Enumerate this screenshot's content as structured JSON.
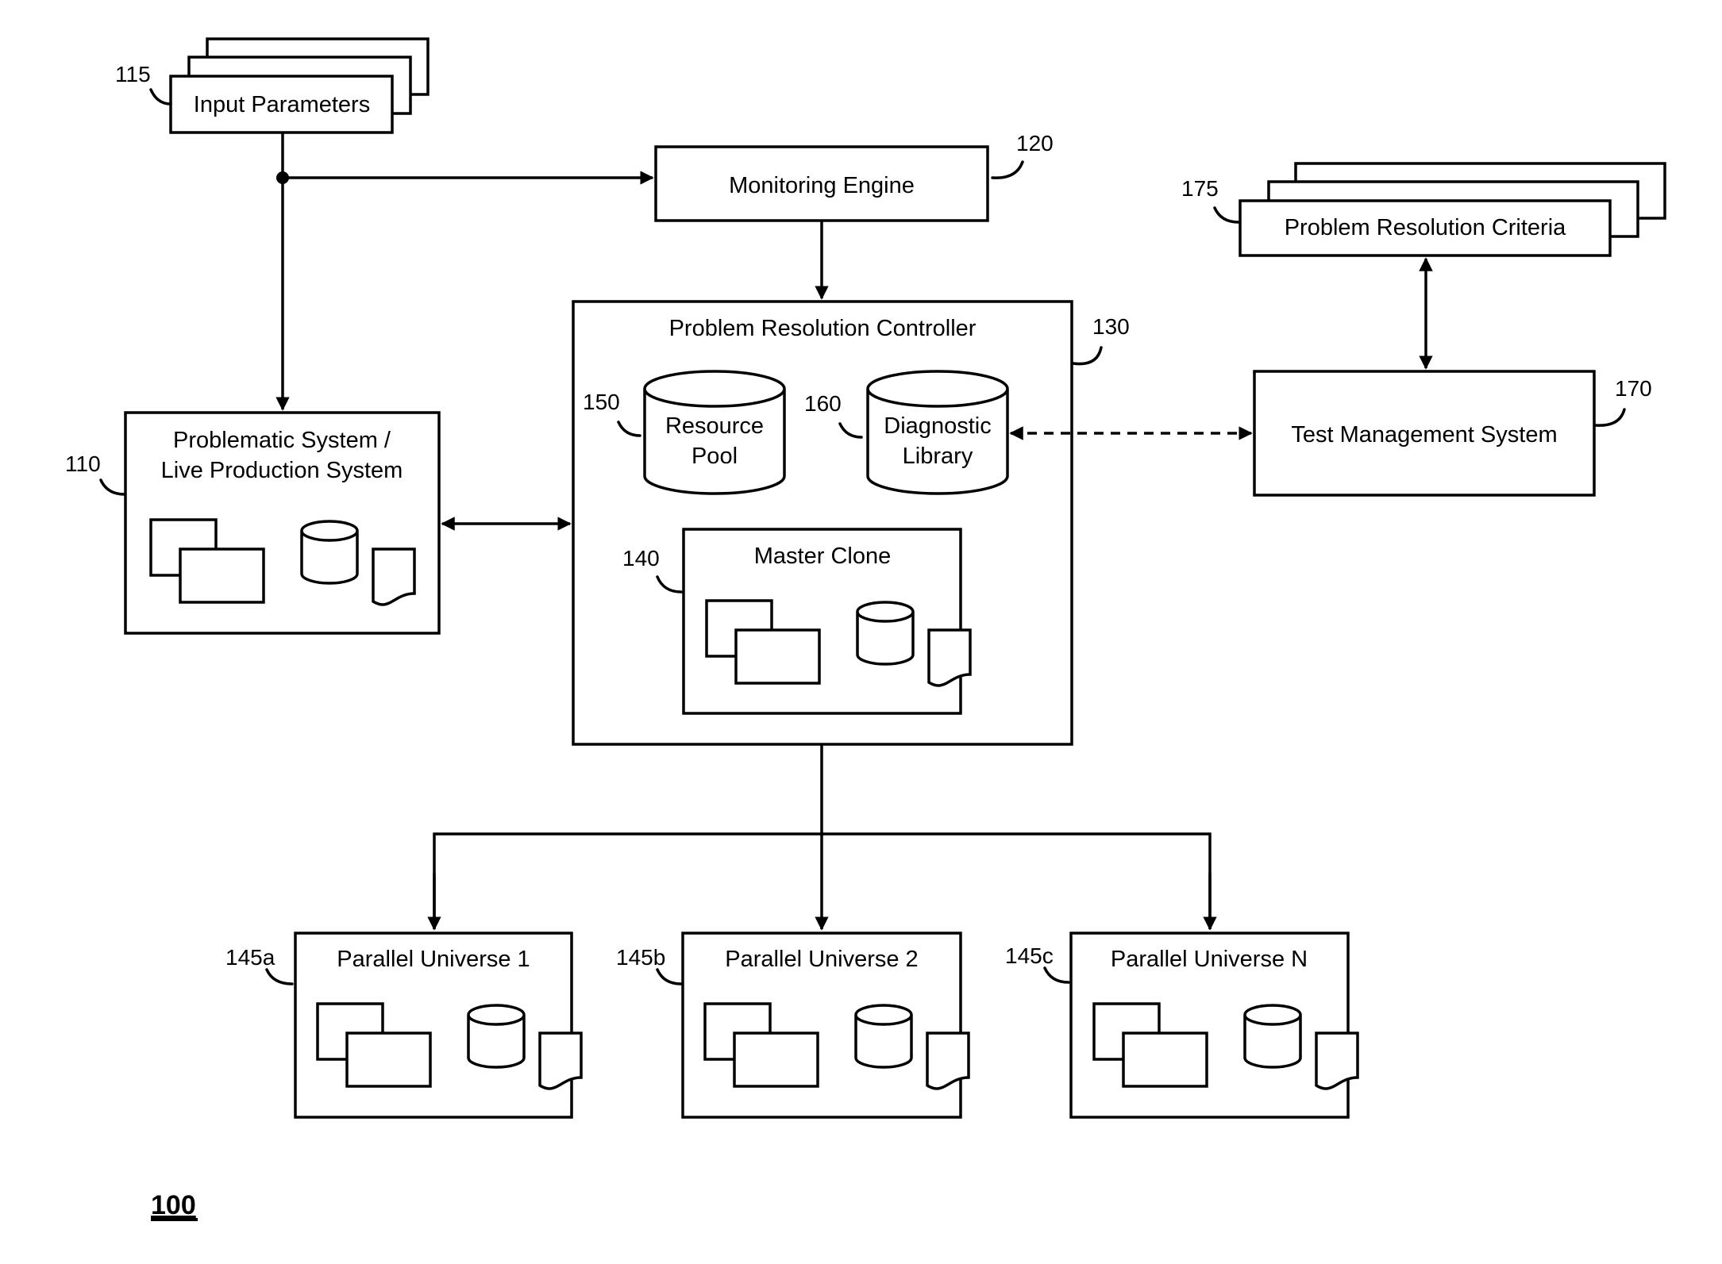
{
  "figure": {
    "number": "100",
    "nodes": {
      "input_parameters": {
        "ref": "115",
        "label": "Input Parameters"
      },
      "monitoring_engine": {
        "ref": "120",
        "label": "Monitoring Engine"
      },
      "problem_resolution_controller": {
        "ref": "130",
        "label": "Problem Resolution Controller"
      },
      "resource_pool": {
        "ref": "150",
        "line1": "Resource",
        "line2": "Pool"
      },
      "diagnostic_library": {
        "ref": "160",
        "line1": "Diagnostic",
        "line2": "Library"
      },
      "master_clone": {
        "ref": "140",
        "label": "Master Clone"
      },
      "problematic_system": {
        "ref": "110",
        "line1": "Problematic System /",
        "line2": "Live Production System"
      },
      "problem_resolution_criteria": {
        "ref": "175",
        "label": "Problem Resolution Criteria"
      },
      "test_management_system": {
        "ref": "170",
        "label": "Test Management System"
      },
      "parallel_universes": [
        {
          "ref": "145a",
          "label": "Parallel Universe 1"
        },
        {
          "ref": "145b",
          "label": "Parallel Universe 2"
        },
        {
          "ref": "145c",
          "label": "Parallel Universe N"
        }
      ]
    },
    "edges": [
      {
        "from": "input_parameters",
        "to": "monitoring_engine",
        "style": "solid",
        "direction": "forward"
      },
      {
        "from": "input_parameters",
        "to": "problematic_system",
        "style": "solid",
        "direction": "forward"
      },
      {
        "from": "monitoring_engine",
        "to": "problem_resolution_controller",
        "style": "solid",
        "direction": "forward"
      },
      {
        "from": "problematic_system",
        "to": "problem_resolution_controller",
        "style": "solid",
        "direction": "both"
      },
      {
        "from": "diagnostic_library",
        "to": "test_management_system",
        "style": "dashed",
        "direction": "both"
      },
      {
        "from": "problem_resolution_criteria",
        "to": "test_management_system",
        "style": "solid",
        "direction": "both"
      },
      {
        "from": "problem_resolution_controller",
        "to": "parallel_universe_1",
        "style": "solid",
        "direction": "forward"
      },
      {
        "from": "problem_resolution_controller",
        "to": "parallel_universe_2",
        "style": "solid",
        "direction": "forward"
      },
      {
        "from": "problem_resolution_controller",
        "to": "parallel_universe_n",
        "style": "solid",
        "direction": "forward"
      }
    ]
  }
}
